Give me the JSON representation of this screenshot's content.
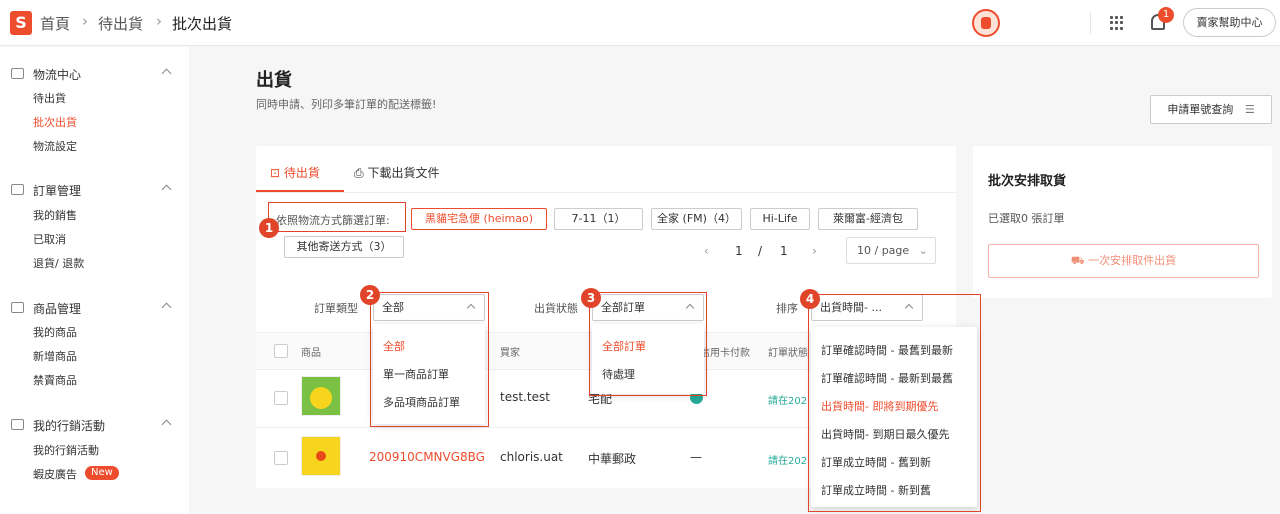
{
  "breadcrumb": [
    "首頁",
    "待出貨",
    "批次出貨"
  ],
  "topbar": {
    "badge_count": "1",
    "help_label": "賣家幫助中心"
  },
  "sidebar": {
    "sections": [
      {
        "title": "物流中心",
        "items": [
          "待出貨",
          "批次出貨",
          "物流設定"
        ]
      },
      {
        "title": "訂單管理",
        "items": [
          "我的銷售",
          "已取消",
          "退貨/ 退款"
        ]
      },
      {
        "title": "商品管理",
        "items": [
          "我的商品",
          "新增商品",
          "禁賣商品"
        ]
      },
      {
        "title": "我的行銷活動",
        "items": [
          "我的行銷活動",
          "蝦皮廣告"
        ]
      }
    ],
    "new_badge": "New"
  },
  "main": {
    "title": "出貨",
    "subtitle": "同時申請、列印多筆訂單的配送標籤!",
    "lookup_btn": "申請單號查詢",
    "tabs": [
      "待出貨",
      "下載出貨文件"
    ],
    "filter_label": "依照物流方式篩選訂單:",
    "chips": [
      "黑貓宅急便 (heimao)",
      "7-11（1）",
      "全家 (FM)（4）",
      "Hi-Life",
      "萊爾富-經濟包",
      "其他寄送方式（3）"
    ],
    "pager": {
      "prev": "‹",
      "current": "1",
      "sep": "/",
      "total": "1",
      "next": "›",
      "page_size": "10 / page"
    },
    "filters": {
      "order_type_label": "訂單類型",
      "order_type_value": "全部",
      "status_label": "出貨狀態",
      "status_value": "全部訂單",
      "sort_label": "排序",
      "sort_value": "出貨時間- ..."
    },
    "table": {
      "headers": [
        "商品",
        "買家",
        "信用卡付款",
        "訂單狀態"
      ],
      "rows": [
        {
          "order_id": "",
          "buyer": "test.test",
          "shipping": "宅配",
          "card": "",
          "status": "請在202"
        },
        {
          "order_id": "200910CMNVG8BG",
          "buyer": "chloris.uat",
          "shipping": "中華郵政",
          "card": "—",
          "status": "請在202"
        }
      ]
    }
  },
  "right_panel": {
    "title": "批次安排取貨",
    "selected": "已選取0 張訂單",
    "button": "一次安排取件出貨"
  },
  "dropdowns": {
    "order_type": [
      "全部",
      "單一商品訂單",
      "多品項商品訂單"
    ],
    "status": [
      "全部訂單",
      "待處理"
    ],
    "sort": [
      "訂單確認時間 - 最舊到最新",
      "訂單確認時間 - 最新到最舊",
      "出貨時間- 即將到期優先",
      "出貨時間- 到期日最久優先",
      "訂單成立時間 - 舊到新",
      "訂單成立時間 - 新到舊"
    ]
  },
  "annotations": [
    "1",
    "2",
    "3",
    "4"
  ],
  "colors": {
    "accent": "#ee4d2d",
    "annotation": "#e0452a",
    "success": "#26aa99"
  }
}
